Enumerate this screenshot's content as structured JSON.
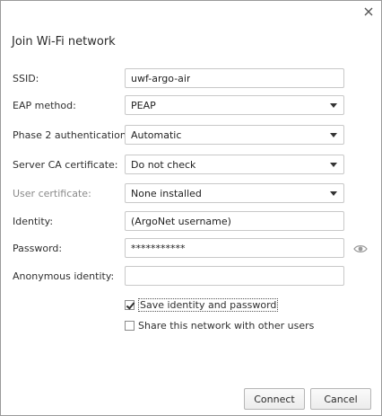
{
  "dialog": {
    "title": "Join Wi-Fi network",
    "close_icon": "close-icon"
  },
  "form": {
    "ssid": {
      "label": "SSID:",
      "value": "uwf-argo-air"
    },
    "eap_method": {
      "label": "EAP method:",
      "value": "PEAP"
    },
    "phase2": {
      "label": "Phase 2 authentication:",
      "value": "Automatic"
    },
    "server_ca": {
      "label": "Server CA certificate:",
      "value": "Do not check"
    },
    "user_cert": {
      "label": "User certificate:",
      "value": "None installed",
      "disabled": true
    },
    "identity": {
      "label": "Identity:",
      "value": "(ArgoNet username)"
    },
    "password": {
      "label": "Password:",
      "value": "***********",
      "reveal_icon": "eye-icon"
    },
    "anonymous_identity": {
      "label": "Anonymous identity:",
      "value": ""
    }
  },
  "options": {
    "save_identity": {
      "label": "Save identity and password",
      "checked": true
    },
    "share_network": {
      "label": "Share this network with other users",
      "checked": false
    }
  },
  "buttons": {
    "connect": "Connect",
    "cancel": "Cancel"
  }
}
